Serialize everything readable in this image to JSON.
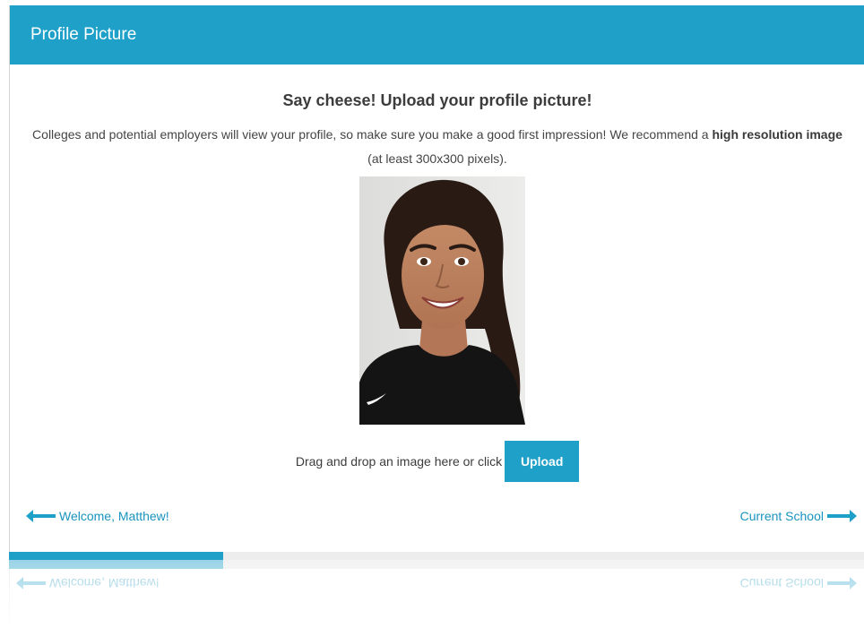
{
  "header": {
    "title": "Profile Picture"
  },
  "content": {
    "heading": "Say cheese! Upload your profile picture!",
    "description_before": "Colleges and potential employers will view your profile, so make sure you make a good first impression! We recommend a ",
    "description_bold": "high resolution image",
    "description_after": " (at least 300x300 pixels)."
  },
  "upload": {
    "drop_text": "Drag and drop an image here or click",
    "button_label": "Upload"
  },
  "navigation": {
    "prev_label": "Welcome, Matthew!",
    "next_label": "Current School"
  },
  "progress": {
    "fraction": 0.25
  },
  "colors": {
    "accent": "#1ea0c9",
    "link": "#1a93bf",
    "text": "#3c3c3c"
  },
  "icons": {
    "prev": "arrow-left-icon",
    "next": "arrow-right-icon"
  }
}
